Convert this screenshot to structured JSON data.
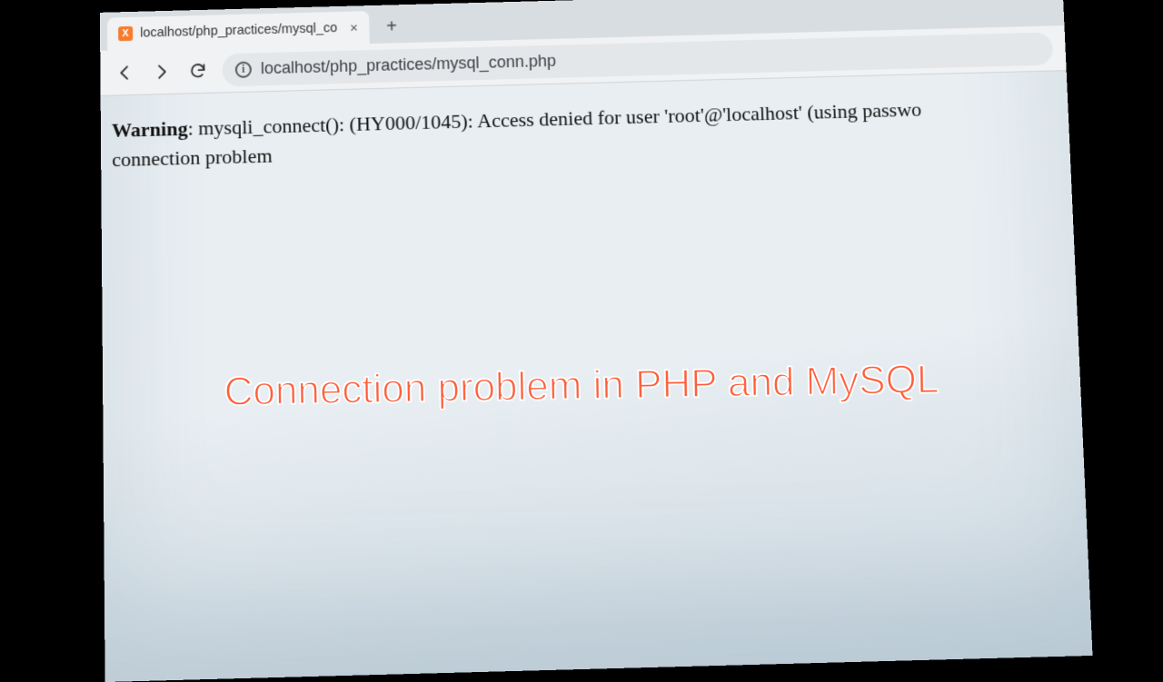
{
  "browser": {
    "tab_title": "localhost/php_practices/mysql_co",
    "favicon_letter": "X",
    "url": "localhost/php_practices/mysql_conn.php"
  },
  "page": {
    "warning_label": "Warning",
    "warning_body": ": mysqli_connect(): (HY000/1045): Access denied for user 'root'@'localhost' (using passwo",
    "line2": "connection problem"
  },
  "caption": "Connection problem in PHP and MySQL"
}
